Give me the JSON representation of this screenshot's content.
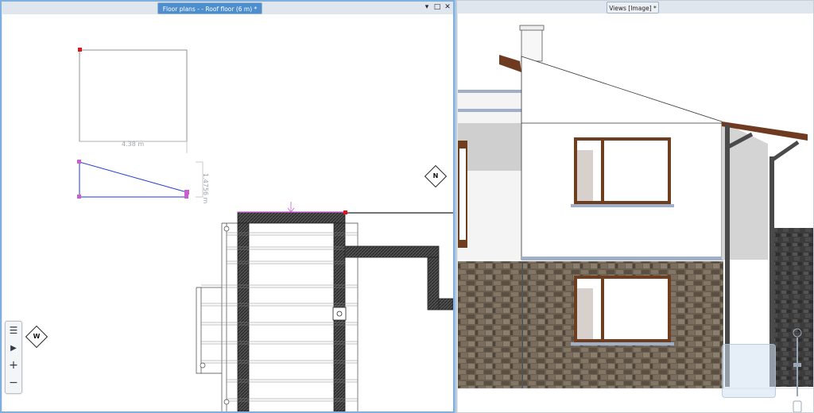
{
  "left_pane": {
    "tab_title": "Floor plans -  - Roof floor (6 m) *",
    "buttons": {
      "dropdown": "▾",
      "maximize": "□",
      "close": "✕"
    },
    "dimension_horizontal": "4.38 m",
    "dimension_vertical": "1.4756 m",
    "compass_n": "N",
    "compass_w": "W",
    "toolbar": {
      "menu": "☰",
      "expand": "▶",
      "zoom_in": "+",
      "zoom_out": "−"
    }
  },
  "right_pane": {
    "tab_title": "Views [Image] *"
  },
  "colors": {
    "accent": "#4d8fce",
    "pane_border": "#7fb0dd",
    "selection_blue": "#1f3bd1",
    "handle_red": "#e0141b",
    "handle_purple": "#c85fd0"
  }
}
